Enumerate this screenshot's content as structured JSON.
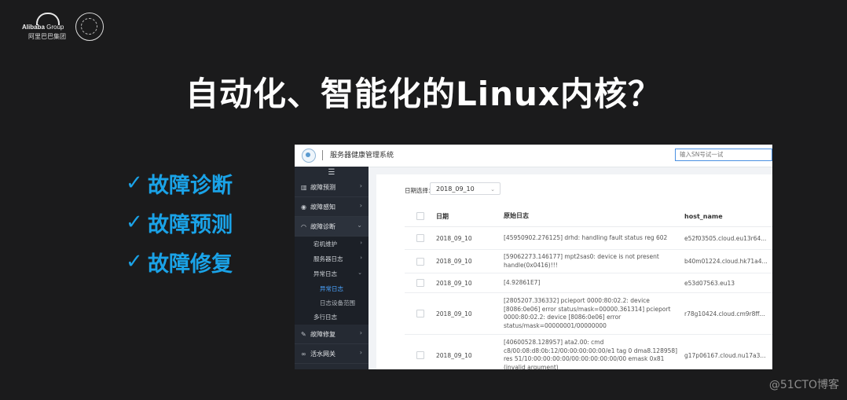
{
  "slide": {
    "alibaba_name": "Alibaba",
    "alibaba_group": " Group",
    "alibaba_cn": "阿里巴巴集团",
    "title": "自动化、智能化的Linux内核？",
    "features": [
      "故障诊断",
      "故障预测",
      "故障修复"
    ],
    "check_glyph": "✓",
    "watermark": "@51CTO博客"
  },
  "app": {
    "title": "服务器健康管理系统",
    "search_placeholder": "输入SN号试一试",
    "sidebar": {
      "menu_icon": "☰",
      "items": [
        {
          "label": "故障预测",
          "icon": "chart-icon"
        },
        {
          "label": "故障感知",
          "icon": "eye-icon"
        },
        {
          "label": "故障诊断",
          "icon": "headset-icon"
        },
        {
          "label": "故障修复",
          "icon": "wrench-icon"
        },
        {
          "label": "活水网关",
          "icon": "link-icon"
        }
      ],
      "sub_items": [
        "宕机维护",
        "服务器日志",
        "异常日志"
      ],
      "leaf_items": [
        "异常日志",
        "日志设备范围"
      ],
      "extra_item": "多行日志"
    },
    "filter": {
      "label": "日期选择：",
      "value": "2018_09_10"
    },
    "table": {
      "headers": [
        "日期",
        "原始日志",
        "host_name"
      ],
      "rows": [
        {
          "date": "2018_09_10",
          "log": "[45950902.276125] drhd: handling fault status reg 602",
          "host": "e52f03505.cloud.eu13r64..."
        },
        {
          "date": "2018_09_10",
          "log": "[59062273.146177] mpt2sas0: device is not present handle(0x0416)!!!",
          "host": "b40m01224.cloud.hk71a4..."
        },
        {
          "date": "2018_09_10",
          "log": "[4.92861E7]",
          "host": "e53d07563.eu13"
        },
        {
          "date": "2018_09_10",
          "log": "[2805207.336332] pcieport 0000:80:02.2: device [8086:0e06] error status/mask=00000.361314] pcieport 0000:80:02.2: device [8086:0e06] error status/mask=00000001/00000000",
          "host": "r78g10424.cloud.cm9r8ff..."
        },
        {
          "date": "2018_09_10",
          "log": "[40600528.128957] ata2.00: cmd c8/00:08:d8:0b:12/00:00:00:00:00/e1 tag 0 dma8.128958] res 51/10:00:00:00:00/00:00:00:00:00/00 emask 0x81 (invalid argument)",
          "host": "g17p06167.cloud.nu17a3..."
        }
      ]
    }
  }
}
